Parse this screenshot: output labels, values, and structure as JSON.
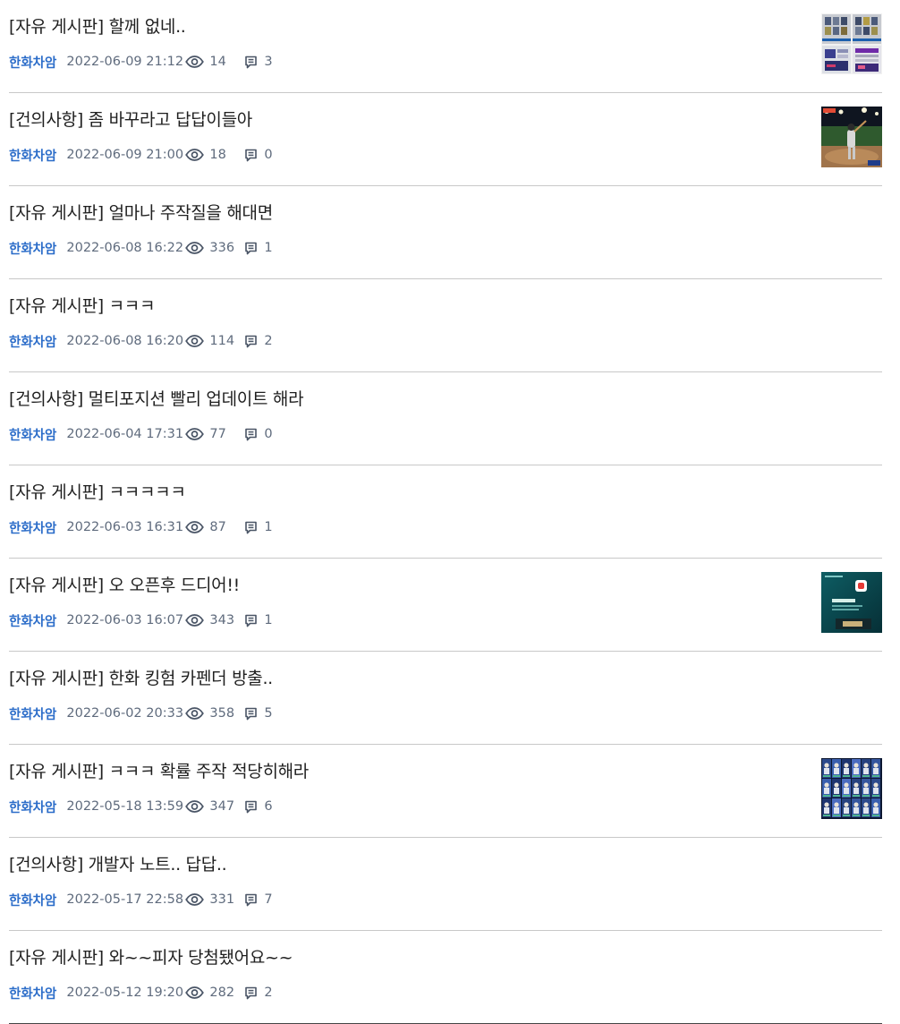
{
  "posts": [
    {
      "title": "[자유 게시판] 할께 없네..",
      "author": "한화차암",
      "date": "2022-06-09 21:12",
      "views": "14",
      "comments": "3",
      "thumb": "screenshot-grid"
    },
    {
      "title": "[건의사항] 좀 바꾸라고 답답이들아",
      "author": "한화차암",
      "date": "2022-06-09 21:00",
      "views": "18",
      "comments": "0",
      "thumb": "baseball-batter"
    },
    {
      "title": "[자유 게시판] 얼마나 주작질을 해대면",
      "author": "한화차암",
      "date": "2022-06-08 16:22",
      "views": "336",
      "comments": "1",
      "thumb": ""
    },
    {
      "title": "[자유 게시판] ㅋㅋㅋ",
      "author": "한화차암",
      "date": "2022-06-08 16:20",
      "views": "114",
      "comments": "2",
      "thumb": ""
    },
    {
      "title": "[건의사항] 멀티포지션 빨리 업데이트 해라",
      "author": "한화차암",
      "date": "2022-06-04 17:31",
      "views": "77",
      "comments": "0",
      "thumb": ""
    },
    {
      "title": "[자유 게시판] ㅋㅋㅋㅋㅋ",
      "author": "한화차암",
      "date": "2022-06-03 16:31",
      "views": "87",
      "comments": "1",
      "thumb": ""
    },
    {
      "title": "[자유 게시판] 오 오픈후 드디어!!",
      "author": "한화차암",
      "date": "2022-06-03 16:07",
      "views": "343",
      "comments": "1",
      "thumb": "teal-app-screen"
    },
    {
      "title": "[자유 게시판] 한화 킹험 카펜더 방출..",
      "author": "한화차암",
      "date": "2022-06-02 20:33",
      "views": "358",
      "comments": "5",
      "thumb": ""
    },
    {
      "title": "[자유 게시판] ㅋㅋㅋ 확률 주작 적당히해라",
      "author": "한화차암",
      "date": "2022-05-18 13:59",
      "views": "347",
      "comments": "6",
      "thumb": "player-cards"
    },
    {
      "title": "[건의사항] 개발자 노트.. 답답..",
      "author": "한화차암",
      "date": "2022-05-17 22:58",
      "views": "331",
      "comments": "7",
      "thumb": ""
    },
    {
      "title": "[자유 게시판] 와~~피자 당첨됐어요~~",
      "author": "한화차암",
      "date": "2022-05-12 19:20",
      "views": "282",
      "comments": "2",
      "thumb": ""
    }
  ],
  "icons": {
    "views": "eye-icon",
    "comments": "comment-icon"
  },
  "colors": {
    "author": "#2c6dc9",
    "meta": "#5f6b7d",
    "title": "#1f1f1f",
    "divider": "#c8c8c8"
  }
}
